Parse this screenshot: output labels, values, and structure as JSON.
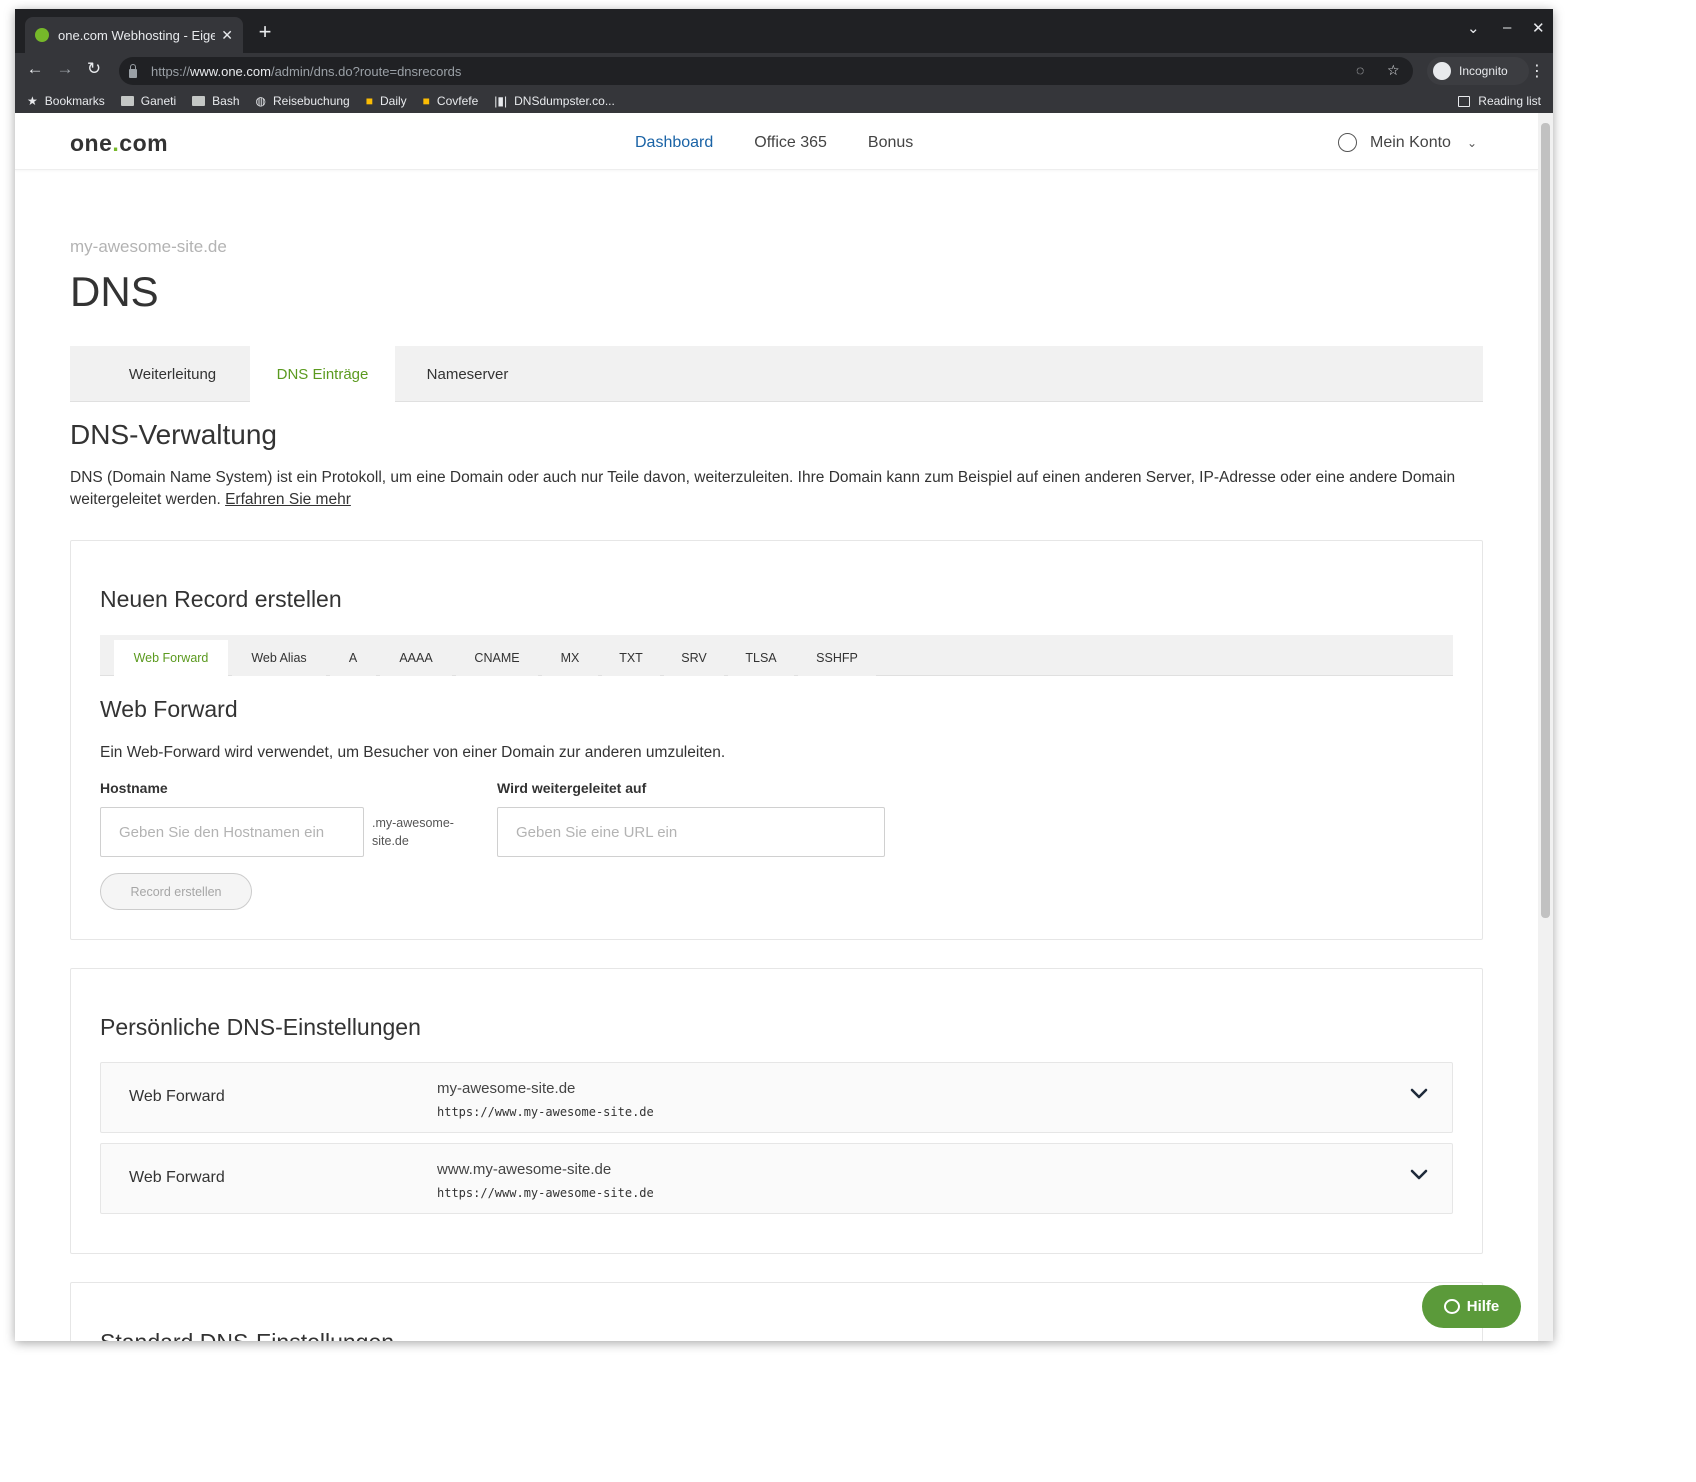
{
  "browser": {
    "tab_title": "one.com Webhosting - Eigene",
    "url_scheme": "https://",
    "url_host": "www.one.com",
    "url_path": "/admin/dns.do?route=dnsrecords",
    "incognito_label": "Incognito",
    "bookmarks": [
      {
        "label": "Bookmarks",
        "icon": "star-icon"
      },
      {
        "label": "Ganeti",
        "icon": "folder-icon"
      },
      {
        "label": "Bash",
        "icon": "folder-icon"
      },
      {
        "label": "Reisebuchung",
        "icon": "globe-icon"
      },
      {
        "label": "Daily",
        "icon": "calendar-icon"
      },
      {
        "label": "Covfefe",
        "icon": "calendar-icon"
      },
      {
        "label": "DNSdumpster.co...",
        "icon": "dns-icon"
      }
    ],
    "reading_list_label": "Reading list"
  },
  "site": {
    "logo_text_a": "one",
    "logo_dot": ".",
    "logo_text_b": "com",
    "nav": [
      "Dashboard",
      "Office 365",
      "Bonus"
    ],
    "account_label": "Mein Konto"
  },
  "page": {
    "domain": "my-awesome-site.de",
    "title": "DNS",
    "tabs": [
      "Weiterleitung",
      "DNS Einträge",
      "Nameserver"
    ],
    "section_title": "DNS-Verwaltung",
    "intro_text": "DNS (Domain Name System) ist ein Protokoll, um eine Domain oder auch nur Teile davon, weiterzuleiten. Ihre Domain kann zum Beispiel auf einen anderen Server, IP-Adresse oder eine andere Domain weitergeleitet werden.",
    "intro_link": "Erfahren Sie mehr"
  },
  "create_record": {
    "title": "Neuen Record erstellen",
    "record_tabs": [
      "Web Forward",
      "Web Alias",
      "A",
      "AAAA",
      "CNAME",
      "MX",
      "TXT",
      "SRV",
      "TLSA",
      "SSHFP"
    ],
    "form_title": "Web Forward",
    "form_description": "Ein Web-Forward wird verwendet, um Besucher von einer Domain zur anderen umzuleiten.",
    "hostname_label": "Hostname",
    "hostname_placeholder": "Geben Sie den Hostnamen ein",
    "hostname_suffix_a": ".my-awesome-",
    "hostname_suffix_b": "site.de",
    "target_label": "Wird weitergeleitet auf",
    "target_placeholder": "Geben Sie eine URL ein",
    "submit_label": "Record erstellen"
  },
  "personal_dns": {
    "title": "Persönliche DNS-Einstellungen",
    "records": [
      {
        "type": "Web Forward",
        "host": "my-awesome-site.de",
        "target": "https://www.my-awesome-site.de"
      },
      {
        "type": "Web Forward",
        "host": "www.my-awesome-site.de",
        "target": "https://www.my-awesome-site.de"
      }
    ]
  },
  "standard_dns": {
    "title": "Standard DNS-Einstellungen"
  },
  "help_button_label": "Hilfe",
  "colors": {
    "brand_green": "#76b82a",
    "active_tab_green": "#5b9a1f",
    "nav_active_blue": "#1a63a6",
    "help_green": "#5b9a3a"
  }
}
